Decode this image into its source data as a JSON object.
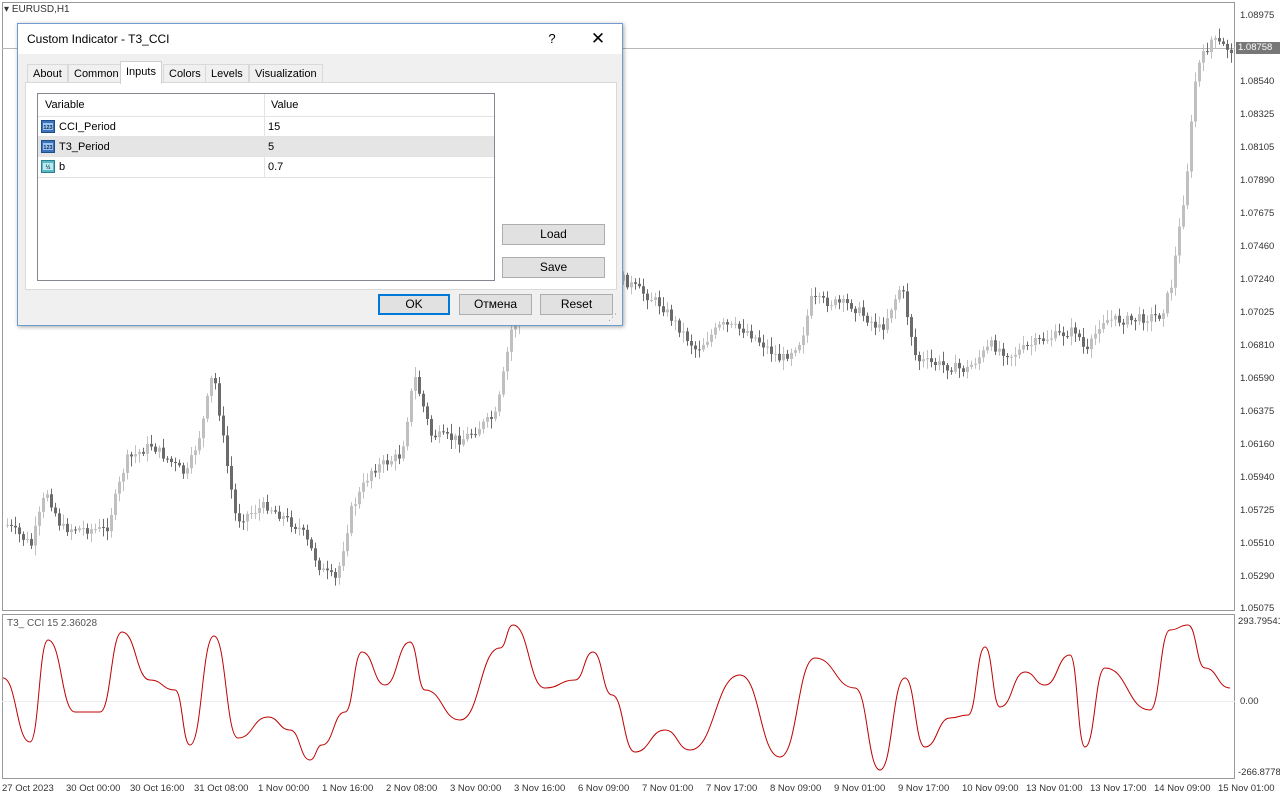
{
  "chart": {
    "symbol": "EURUSD,H1",
    "current_price": "1.08758",
    "price_axis": [
      "1.08975",
      "1.08540",
      "1.08325",
      "1.08105",
      "1.07890",
      "1.07675",
      "1.07460",
      "1.07240",
      "1.07025",
      "1.06810",
      "1.06590",
      "1.06375",
      "1.06160",
      "1.05940",
      "1.05725",
      "1.05510",
      "1.05290",
      "1.05075"
    ],
    "time_axis": [
      "27 Oct 2023",
      "30 Oct 00:00",
      "30 Oct 16:00",
      "31 Oct 08:00",
      "1 Nov 00:00",
      "1 Nov 16:00",
      "2 Nov 08:00",
      "3 Nov 00:00",
      "3 Nov 16:00",
      "6 Nov 09:00",
      "7 Nov 01:00",
      "7 Nov 17:00",
      "8 Nov 09:00",
      "9 Nov 01:00",
      "9 Nov 17:00",
      "10 Nov 09:00",
      "13 Nov 01:00",
      "13 Nov 17:00",
      "14 Nov 09:00",
      "15 Nov 01:00"
    ],
    "indicator_label": "T3_ CCI 15 2.36028",
    "indicator_axis": [
      "293.79541",
      "0.00",
      "-266.8778"
    ],
    "colors": {
      "bull_candle": "#c0c0c0",
      "bear_candle": "#6b6b6b",
      "cci_line": "#c00000"
    }
  },
  "dialog": {
    "title": "Custom Indicator - T3_CCI",
    "help_label": "?",
    "close_label": "✕",
    "tabs": [
      "About",
      "Common",
      "Inputs",
      "Colors",
      "Levels",
      "Visualization"
    ],
    "active_tab": "Inputs",
    "table_headers": {
      "variable": "Variable",
      "value": "Value"
    },
    "params": [
      {
        "name": "CCI_Period",
        "value": "15",
        "icon": "integer-icon"
      },
      {
        "name": "T3_Period",
        "value": "5",
        "icon": "integer-icon"
      },
      {
        "name": "b",
        "value": "0.7",
        "icon": "double-icon"
      }
    ],
    "buttons": {
      "load": "Load",
      "save": "Save",
      "ok": "OK",
      "cancel": "Отмена",
      "reset": "Reset"
    }
  }
}
